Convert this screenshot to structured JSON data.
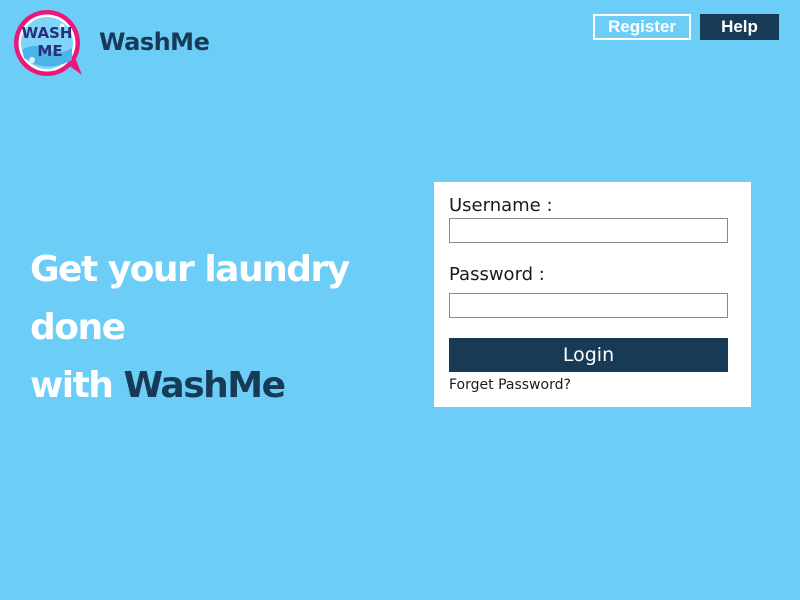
{
  "brand": {
    "name": "WashMe",
    "logo_text_line1": "WASH",
    "logo_text_line2": "ME"
  },
  "nav": {
    "register_label": "Register",
    "help_label": "Help"
  },
  "hero": {
    "line1": "Get your laundry done",
    "line2_prefix": "with ",
    "line2_brand": "WashMe"
  },
  "login": {
    "username_label": "Username :",
    "username_value": "",
    "password_label": "Password :",
    "password_value": "",
    "submit_label": "Login",
    "forgot_label": "Forget Password?"
  },
  "colors": {
    "background": "#6ccdf6",
    "brand_dark": "#173a56",
    "logo_ring": "#e8197a",
    "card": "#ffffff"
  },
  "icons": {
    "logo": "speech-bubble-logo"
  }
}
